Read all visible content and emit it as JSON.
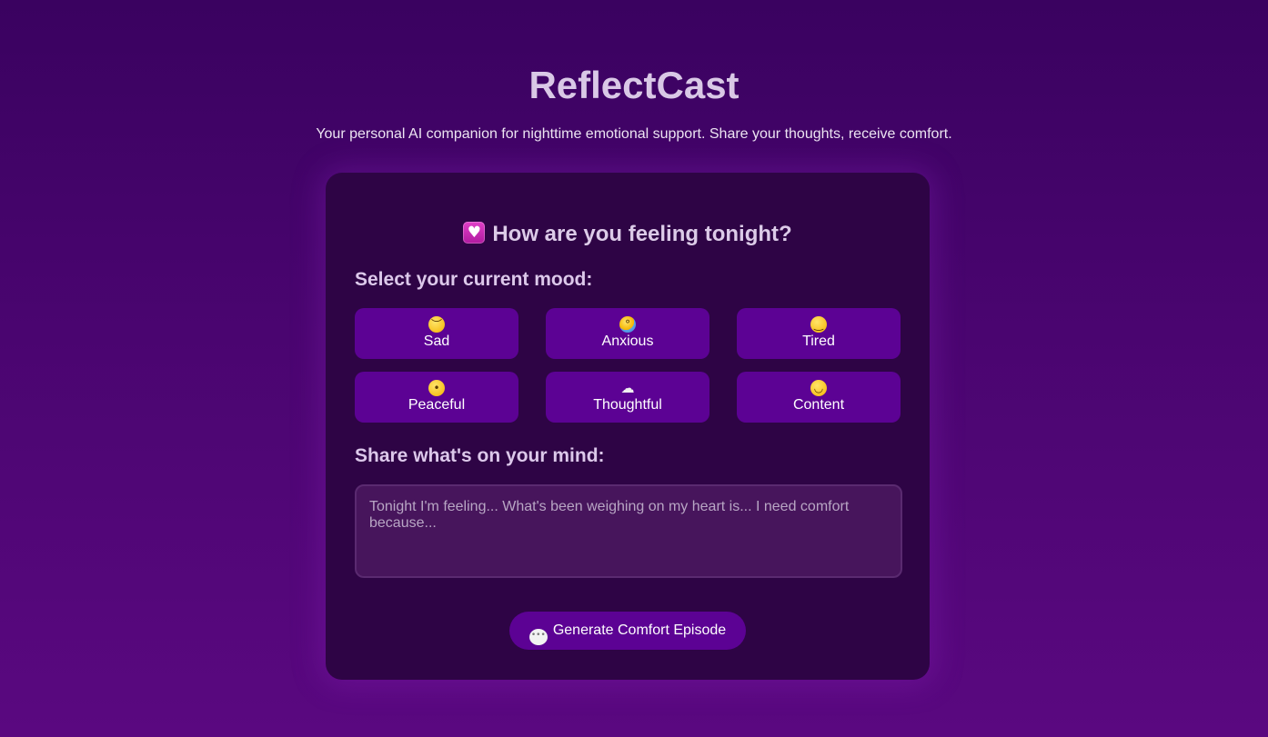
{
  "header": {
    "title": "ReflectCast",
    "subtitle": "Your personal AI companion for nighttime emotional support. Share your thoughts, receive comfort."
  },
  "card": {
    "heading": "How are you feeling tonight?",
    "heading_icon": "heart-icon",
    "mood_label": "Select your current mood:",
    "moods": [
      {
        "emoji": "😔",
        "label": "Sad",
        "icon": "sad-face-icon"
      },
      {
        "emoji": "😰",
        "label": "Anxious",
        "icon": "anxious-face-icon"
      },
      {
        "emoji": "😴",
        "label": "Tired",
        "icon": "sleeping-face-icon"
      },
      {
        "emoji": "🙂",
        "label": "Peaceful",
        "icon": "smiling-face-icon"
      },
      {
        "emoji": "☁",
        "label": "Thoughtful",
        "icon": "cloud-icon"
      },
      {
        "emoji": "😊",
        "label": "Content",
        "icon": "happy-face-icon"
      }
    ],
    "share_label": "Share what's on your mind:",
    "textarea_placeholder": "Tonight I'm feeling... What's been weighing on my heart is... I need comfort because...",
    "textarea_value": "",
    "generate_label": "Generate Comfort Episode",
    "generate_icon": "speech-bubble-icon"
  },
  "colors": {
    "background_top": "#3a0260",
    "background_bottom": "#5a0880",
    "card": "#2e0445",
    "button": "#5c0294",
    "input": "#47155c"
  }
}
